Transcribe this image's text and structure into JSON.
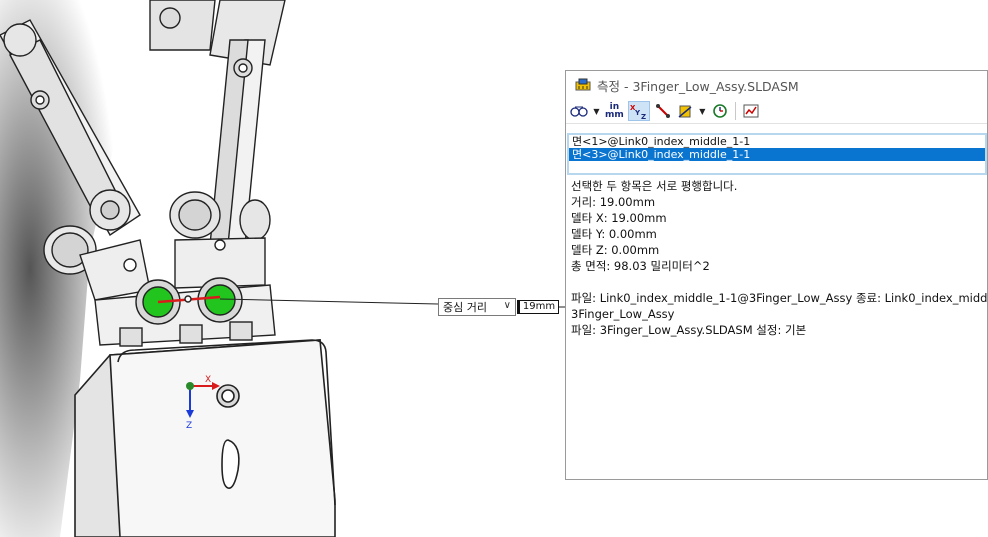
{
  "window": {
    "title": "측정 - 3Finger_Low_Assy.SLDASM"
  },
  "toolbar": {
    "items": [
      {
        "icon": "arc-condition-icon"
      },
      {
        "icon": "units-in-mm-icon",
        "label_top": "in",
        "label_bottom": "mm"
      },
      {
        "icon": "xyz-delta-icon",
        "label": "XYZ"
      },
      {
        "icon": "point-to-point-icon"
      },
      {
        "icon": "projection-icon"
      },
      {
        "icon": "history-icon"
      },
      {
        "icon": "sensor-icon"
      }
    ]
  },
  "selections": [
    {
      "label": "면<1>@Link0_index_middle_1-1",
      "selected": false
    },
    {
      "label": "면<3>@Link0_index_middle_1-1",
      "selected": true
    }
  ],
  "results": {
    "parallel_note": "선택한 두 항목은 서로 평행합니다.",
    "distance": "거리: 19.00mm",
    "delta_x": "델타 X: 19.00mm",
    "delta_y": "델타 Y: 0.00mm",
    "delta_z": "델타 Z: 0.00mm",
    "total_area": "총 면적: 98.03 밀리미터^2",
    "file_line1": "파일: Link0_index_middle_1-1@3Finger_Low_Assy 종료: Link0_index_midd",
    "file_line2": "3Finger_Low_Assy",
    "file_line3": "파일: 3Finger_Low_Assy.SLDASM 설정: 기본"
  },
  "callout": {
    "mode": "중심 거리",
    "value": "19mm"
  },
  "triad": {
    "x_label": "X",
    "z_label": "Z"
  },
  "colors": {
    "selection_blue": "#0a74d1",
    "list_border": "#b6d7ee",
    "face_green": "#22c51e",
    "measure_red": "#d81b1b"
  }
}
